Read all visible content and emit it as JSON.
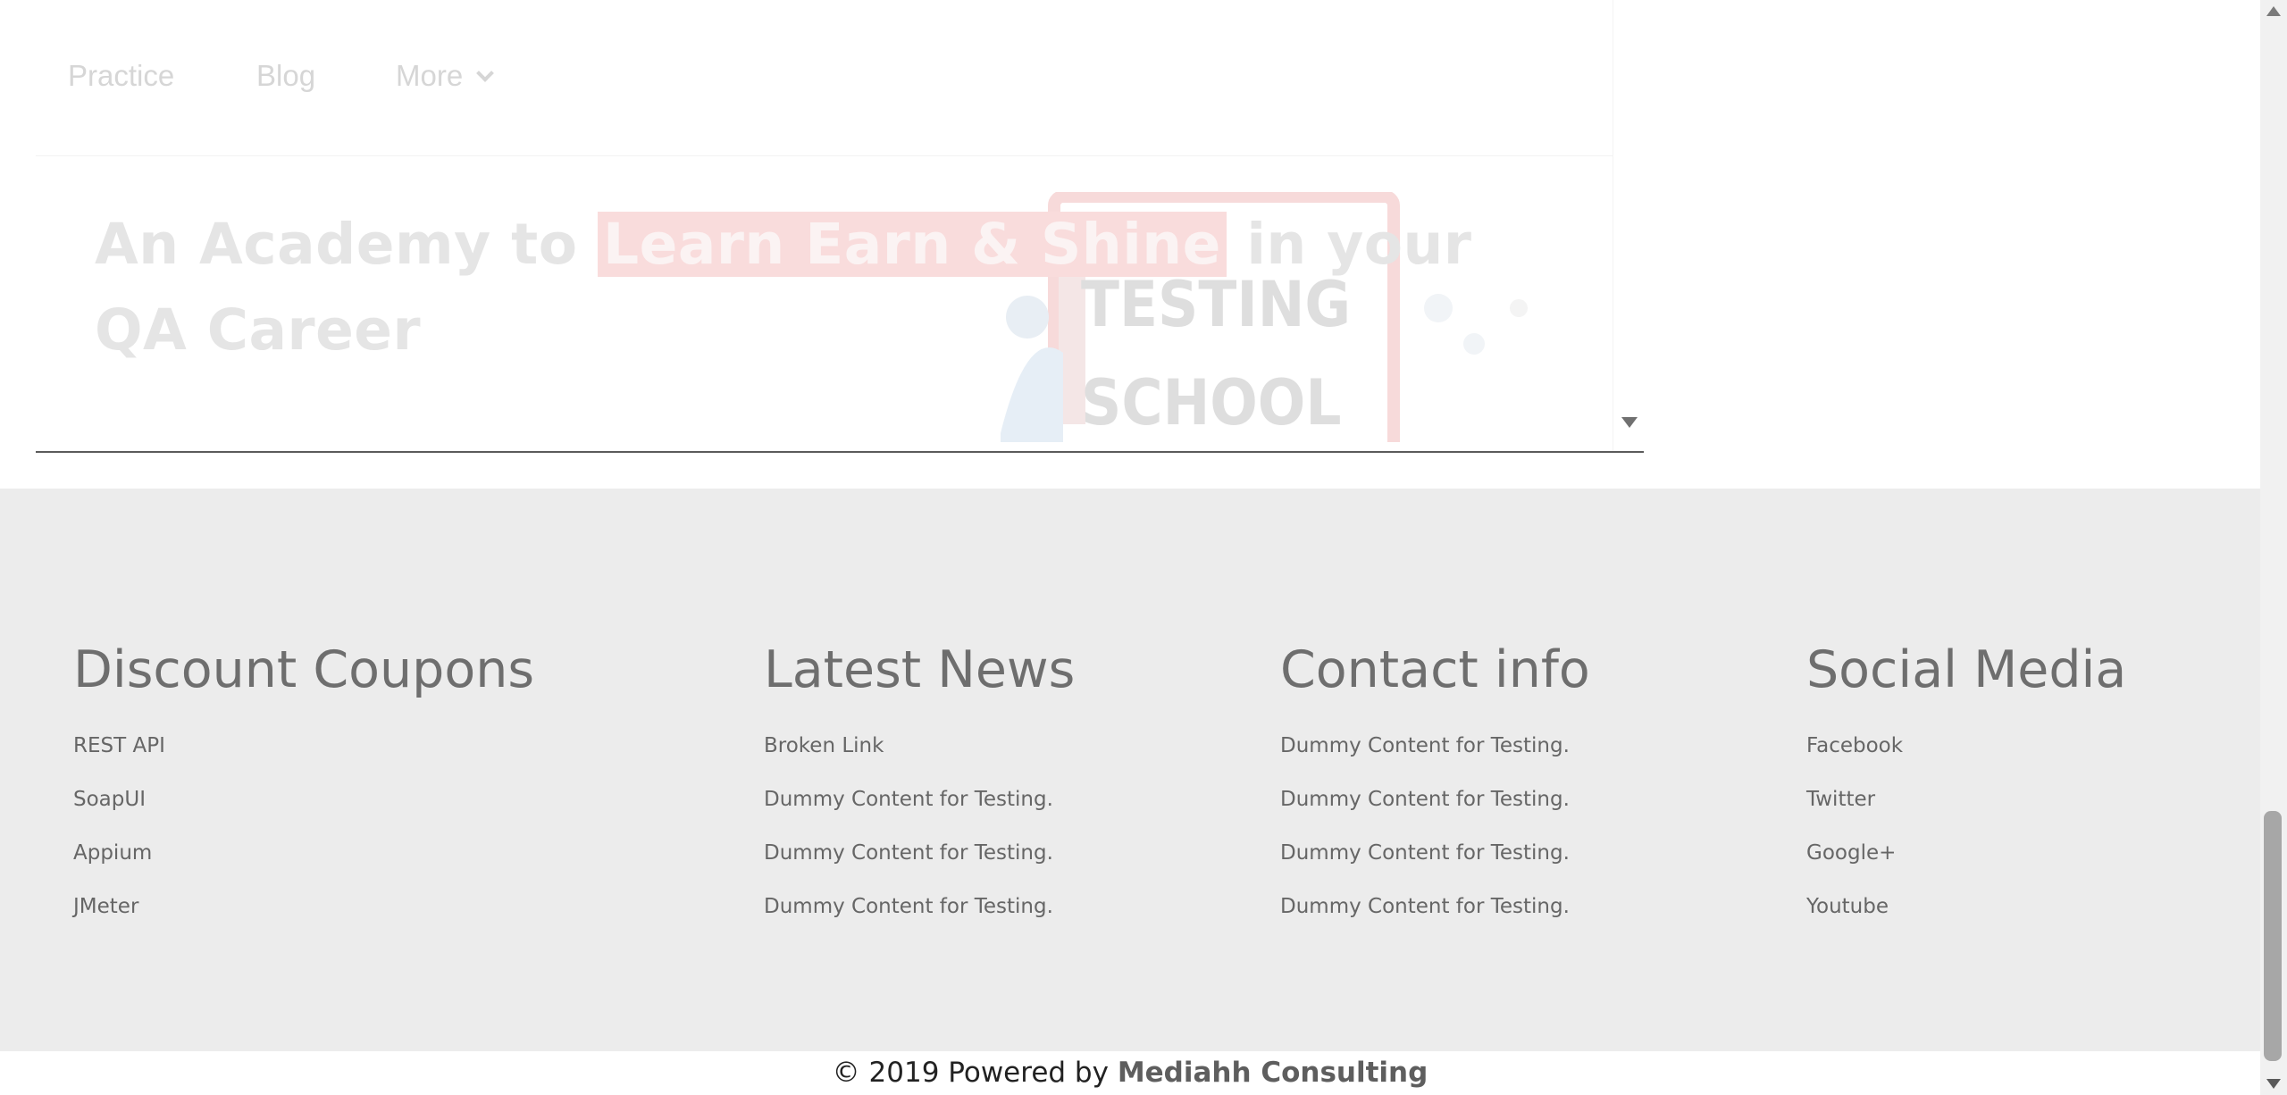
{
  "frame": {
    "nav": {
      "practice": "Practice",
      "blog": "Blog",
      "more": "More"
    },
    "hero": {
      "title_before": "An Academy to ",
      "title_highlight": "Learn Earn & Shine",
      "title_after": "  in your QA Career",
      "image_text_line1": "TESTING",
      "image_text_line2": "SCHOOL"
    }
  },
  "footer": {
    "coupons": {
      "heading": "Discount Coupons",
      "items": [
        "REST API",
        "SoapUI",
        "Appium",
        "JMeter"
      ]
    },
    "news": {
      "heading": "Latest News",
      "items": [
        "Broken Link",
        "Dummy Content for Testing.",
        "Dummy Content for Testing.",
        "Dummy Content for Testing."
      ]
    },
    "contact": {
      "heading": "Contact info",
      "items": [
        "Dummy Content for Testing.",
        "Dummy Content for Testing.",
        "Dummy Content for Testing.",
        "Dummy Content for Testing."
      ]
    },
    "social": {
      "heading": "Social Media",
      "items": [
        "Facebook",
        "Twitter",
        "Google+",
        "Youtube"
      ]
    }
  },
  "copyright": {
    "prefix": "© 2019 Powered by ",
    "company": "Mediahh Consulting"
  },
  "colors": {
    "footer_bg": "#ececec",
    "highlight_bg": "#f9dcdc",
    "heading_text": "#6e6e6e"
  }
}
